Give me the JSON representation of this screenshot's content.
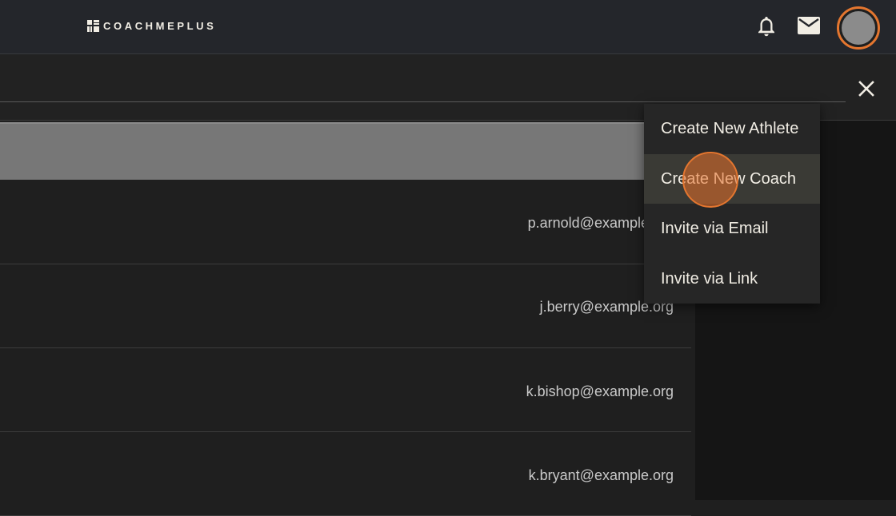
{
  "app": {
    "logo_text": "COACHMEPLUS"
  },
  "header": {
    "icons": [
      "bell-icon",
      "mail-icon",
      "avatar"
    ]
  },
  "search": {
    "value": "",
    "placeholder": ""
  },
  "users": [
    {
      "email": "p.arnold@example.org"
    },
    {
      "email": "j.berry@example.org"
    },
    {
      "email": "k.bishop@example.org"
    },
    {
      "email": "k.bryant@example.org"
    }
  ],
  "add_menu": {
    "items": [
      {
        "label": "Create New Athlete"
      },
      {
        "label": "Create New Coach"
      },
      {
        "label": "Invite via Email"
      },
      {
        "label": "Invite via Link"
      }
    ],
    "highlighted": "Create New Coach"
  },
  "colors": {
    "accent": "#e4762f",
    "topbar": "#24262b",
    "background": "#1f1f1f"
  }
}
